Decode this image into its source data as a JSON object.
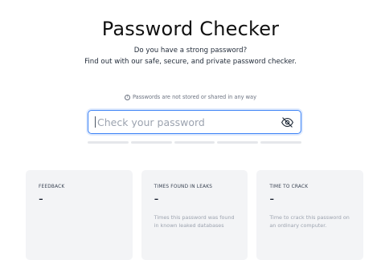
{
  "header": {
    "title": "Password Checker",
    "subtitle_line1": "Do you have a strong password?",
    "subtitle_line2": "Find out with our safe, secure, and private password checker."
  },
  "privacy_note": {
    "text": "Passwords are not stored or shared in any way",
    "icon": "info-icon"
  },
  "password_input": {
    "value": "",
    "placeholder": "Check your password",
    "toggle_icon": "eye-slash-icon",
    "focus_color": "#3b82f6"
  },
  "strength_meter": {
    "segments": 5,
    "filled": 0
  },
  "cards": [
    {
      "label": "FEEDBACK",
      "value": "-",
      "description": ""
    },
    {
      "label": "TIMES FOUND IN LEAKS",
      "value": "-",
      "description": "Times this password was found in known leaked databases"
    },
    {
      "label": "TIME TO CRACK",
      "value": "-",
      "description": "Time to crack this password on an ordinary computer."
    }
  ]
}
